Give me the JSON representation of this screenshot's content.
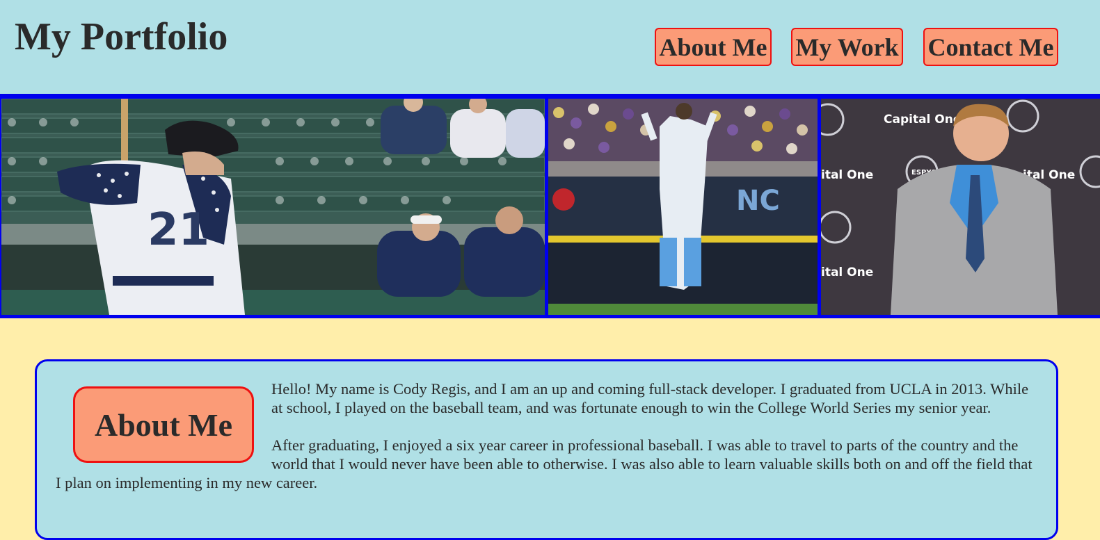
{
  "header": {
    "title": "My Portfolio",
    "nav": [
      {
        "label": "About Me"
      },
      {
        "label": "My Work"
      },
      {
        "label": "Contact Me"
      }
    ]
  },
  "banner": {
    "photos": [
      {
        "jersey_number": "21"
      },
      {
        "scoreboard_text": ""
      },
      {
        "backdrop_text": "Capital One",
        "backdrop_text_2": "ESPYS"
      }
    ]
  },
  "about": {
    "heading": "About Me",
    "paragraphs": [
      "Hello! My name is Cody Regis, and I am an up and coming full-stack developer. I graduated from UCLA in 2013. While at school, I played on the baseball team, and was fortunate enough to win the College World Series my senior year.",
      "After graduating, I enjoyed a six year career in professional baseball. I was able to travel to parts of the country and the world that I would never have been able to otherwise. I was also able to learn valuable skills both on and off the field that I plan on implementing in my new career."
    ]
  },
  "colors": {
    "header_bg": "#b0e0e6",
    "page_bg": "#ffeeaa",
    "button_bg": "#fb9b77",
    "button_border": "#ee1111",
    "frame_border": "#0000ee"
  }
}
